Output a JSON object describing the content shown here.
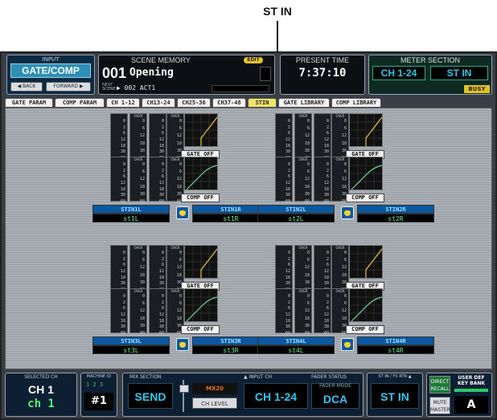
{
  "callout": {
    "label": "ST IN"
  },
  "header": {
    "input": {
      "label": "INPUT",
      "title": "GATE/COMP",
      "back": "◀ BACK",
      "forward": "FORWARD ▶"
    },
    "scene": {
      "label": "SCENE MEMORY",
      "edit": "EDIT",
      "number": "001",
      "name": "Opening",
      "next_label": "NEXT SCENE",
      "next_value": "▶ 002 ACT1"
    },
    "time": {
      "label": "PRESENT TIME",
      "value": "7:37:10"
    },
    "meter": {
      "label": "METER SECTION",
      "ch": "CH 1-24",
      "stin": "ST IN",
      "busy": "BUSY"
    }
  },
  "tabs": [
    {
      "label": "GATE PARAM"
    },
    {
      "label": "COMP PARAM"
    },
    {
      "label": "CH 1-12"
    },
    {
      "label": "CH13-24"
    },
    {
      "label": "CH25-36"
    },
    {
      "label": "CH37-48"
    },
    {
      "label": "STIN"
    },
    {
      "label": "GATE LIBRARY"
    },
    {
      "label": "COMP LIBRARY"
    }
  ],
  "meter_scale": [
    "0",
    "2",
    "6",
    "12",
    "18",
    "30",
    "60"
  ],
  "meter_scale_right": [
    "0",
    "6",
    "12",
    "18",
    "30",
    "60"
  ],
  "meter_over": "OVER",
  "buttons": {
    "gate_off": "GATE OFF",
    "comp_off": "COMP OFF"
  },
  "channels": [
    {
      "left_id": "STIN1L",
      "left_name": "st1L",
      "right_id": "STIN1R",
      "right_name": "st1R"
    },
    {
      "left_id": "STIN2L",
      "left_name": "st2L",
      "right_id": "STIN2R",
      "right_name": "st2R"
    },
    {
      "left_id": "STIN3L",
      "left_name": "st3L",
      "right_id": "STIN3R",
      "right_name": "st3R"
    },
    {
      "left_id": "STIN4L",
      "left_name": "st4L",
      "right_id": "STIN4R",
      "right_name": "st4R"
    }
  ],
  "footer": {
    "selected_ch": {
      "label": "SELECTED CH",
      "value1": "CH 1",
      "value2": "ch 1"
    },
    "machine": {
      "label": "MACHINE ID",
      "indicator": "1 2 3",
      "value": "#1"
    },
    "mix": {
      "label": "MIX SECTION",
      "send": "SEND",
      "mix20": "MX20",
      "chlevel": "CH LEVEL"
    },
    "input_ch": {
      "label": "▲ INPUT CH",
      "value": "CH 1-24"
    },
    "fader": {
      "label": "FADER STATUS",
      "mode": "FADER MODE",
      "value": "DCA"
    },
    "stin": {
      "label": "ST IN / FX RTN ▲",
      "value": "ST IN"
    },
    "right": {
      "direct": "DIRECT RECALL",
      "mute": "MUTE MASTER",
      "ukb_label": "USER DEF KEY BANK",
      "ukb_value": "A"
    }
  },
  "colors": {
    "accent": "#2fc8ee",
    "active_tab": "#efe36a",
    "ch_label": "#0b57a0",
    "name_green": "#6df28a"
  }
}
